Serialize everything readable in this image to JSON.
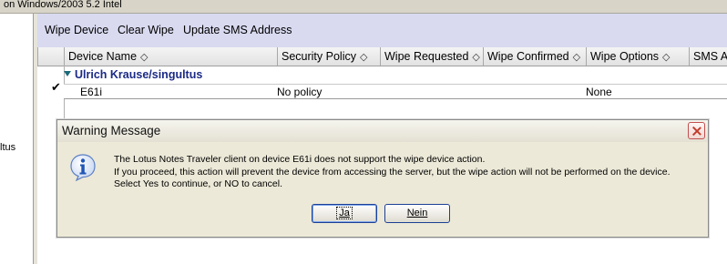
{
  "window": {
    "title_fragment": "on Windows/2003 5.2 Intel"
  },
  "left_pane": {
    "fragment": "ltus"
  },
  "toolbar": {
    "wipe_device": "Wipe Device",
    "clear_wipe": "Clear Wipe",
    "update_sms": "Update SMS Address"
  },
  "table": {
    "columns": [
      "Device Name",
      "Security Policy",
      "Wipe Requested",
      "Wipe Confirmed",
      "Wipe Options",
      "SMS Ad"
    ],
    "sort_glyph": "◇",
    "group": "Ulrich Krause/singultus",
    "row": {
      "check": "✔",
      "device": "E61i",
      "policy": "No policy",
      "options": "None"
    }
  },
  "dialog": {
    "title": "Warning Message",
    "icon": "info-icon",
    "lines": [
      "The Lotus Notes Traveler client on device E61i does not support the wipe device action.",
      "If you proceed, this action will prevent the device from accessing the server, but the wipe action will not be performed on the device.",
      "Select Yes to continue, or NO to cancel."
    ],
    "yes": "Ja",
    "no": "Nein"
  }
}
